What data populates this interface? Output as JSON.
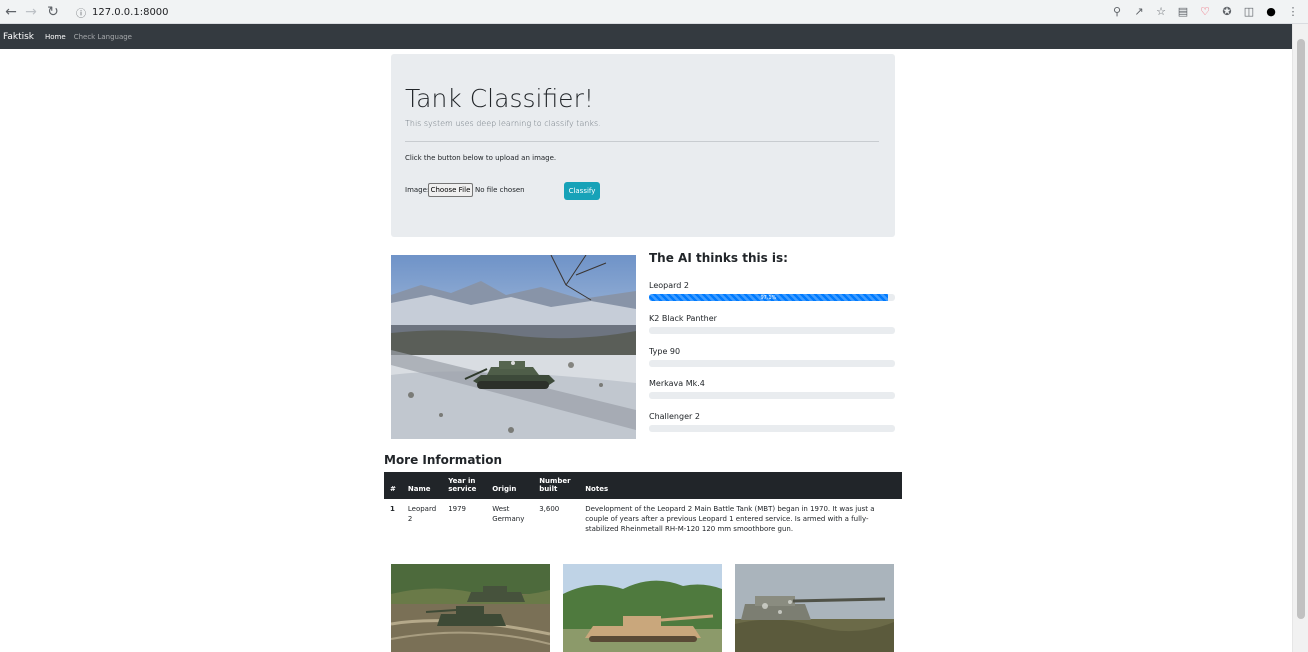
{
  "browser": {
    "url": "127.0.0.1:8000",
    "back_icon": "back-arrow-icon",
    "forward_icon": "forward-arrow-icon",
    "reload_icon": "reload-icon"
  },
  "navbar": {
    "brand": "Faktisk",
    "links": [
      {
        "label": "Home",
        "active": true
      },
      {
        "label": "Check Language",
        "active": false
      }
    ]
  },
  "jumbotron": {
    "title": "Tank Classifier!",
    "lead": "This system uses deep learning to classify tanks.",
    "instruction": "Click the button below to upload an image.",
    "image_label": "Image:",
    "choose_file_label": "Choose File",
    "no_file_text": "No file chosen",
    "classify_label": "Classify"
  },
  "predictions": {
    "title": "The AI thinks this is:",
    "items": [
      {
        "name": "Leopard 2",
        "percent": 97.1,
        "label": "97.1%"
      },
      {
        "name": "K2 Black Panther",
        "percent": 0,
        "label": ""
      },
      {
        "name": "Type 90",
        "percent": 0,
        "label": ""
      },
      {
        "name": "Merkava Mk.4",
        "percent": 0,
        "label": ""
      },
      {
        "name": "Challenger 2",
        "percent": 0,
        "label": ""
      }
    ],
    "bar_color": "#007bff"
  },
  "more_info": {
    "title": "More Information",
    "columns": [
      "#",
      "Name",
      "Year in service",
      "Origin",
      "Number built",
      "Notes"
    ],
    "rows": [
      [
        "1",
        "Leopard 2",
        "1979",
        "West Germany",
        "3,600",
        "Development of the Leopard 2 Main Battle Tank (MBT) began in 1970. It was just a couple of years after a previous Leopard 1 entered service. Is armed with a fully-stabilized Rheinmetall RH-M-120 120 mm smoothbore gun."
      ]
    ]
  },
  "colors": {
    "navbar": "#343a40",
    "jumbotron": "#e9ecef",
    "classify_button": "#17a2b8",
    "table_header": "#212529"
  }
}
